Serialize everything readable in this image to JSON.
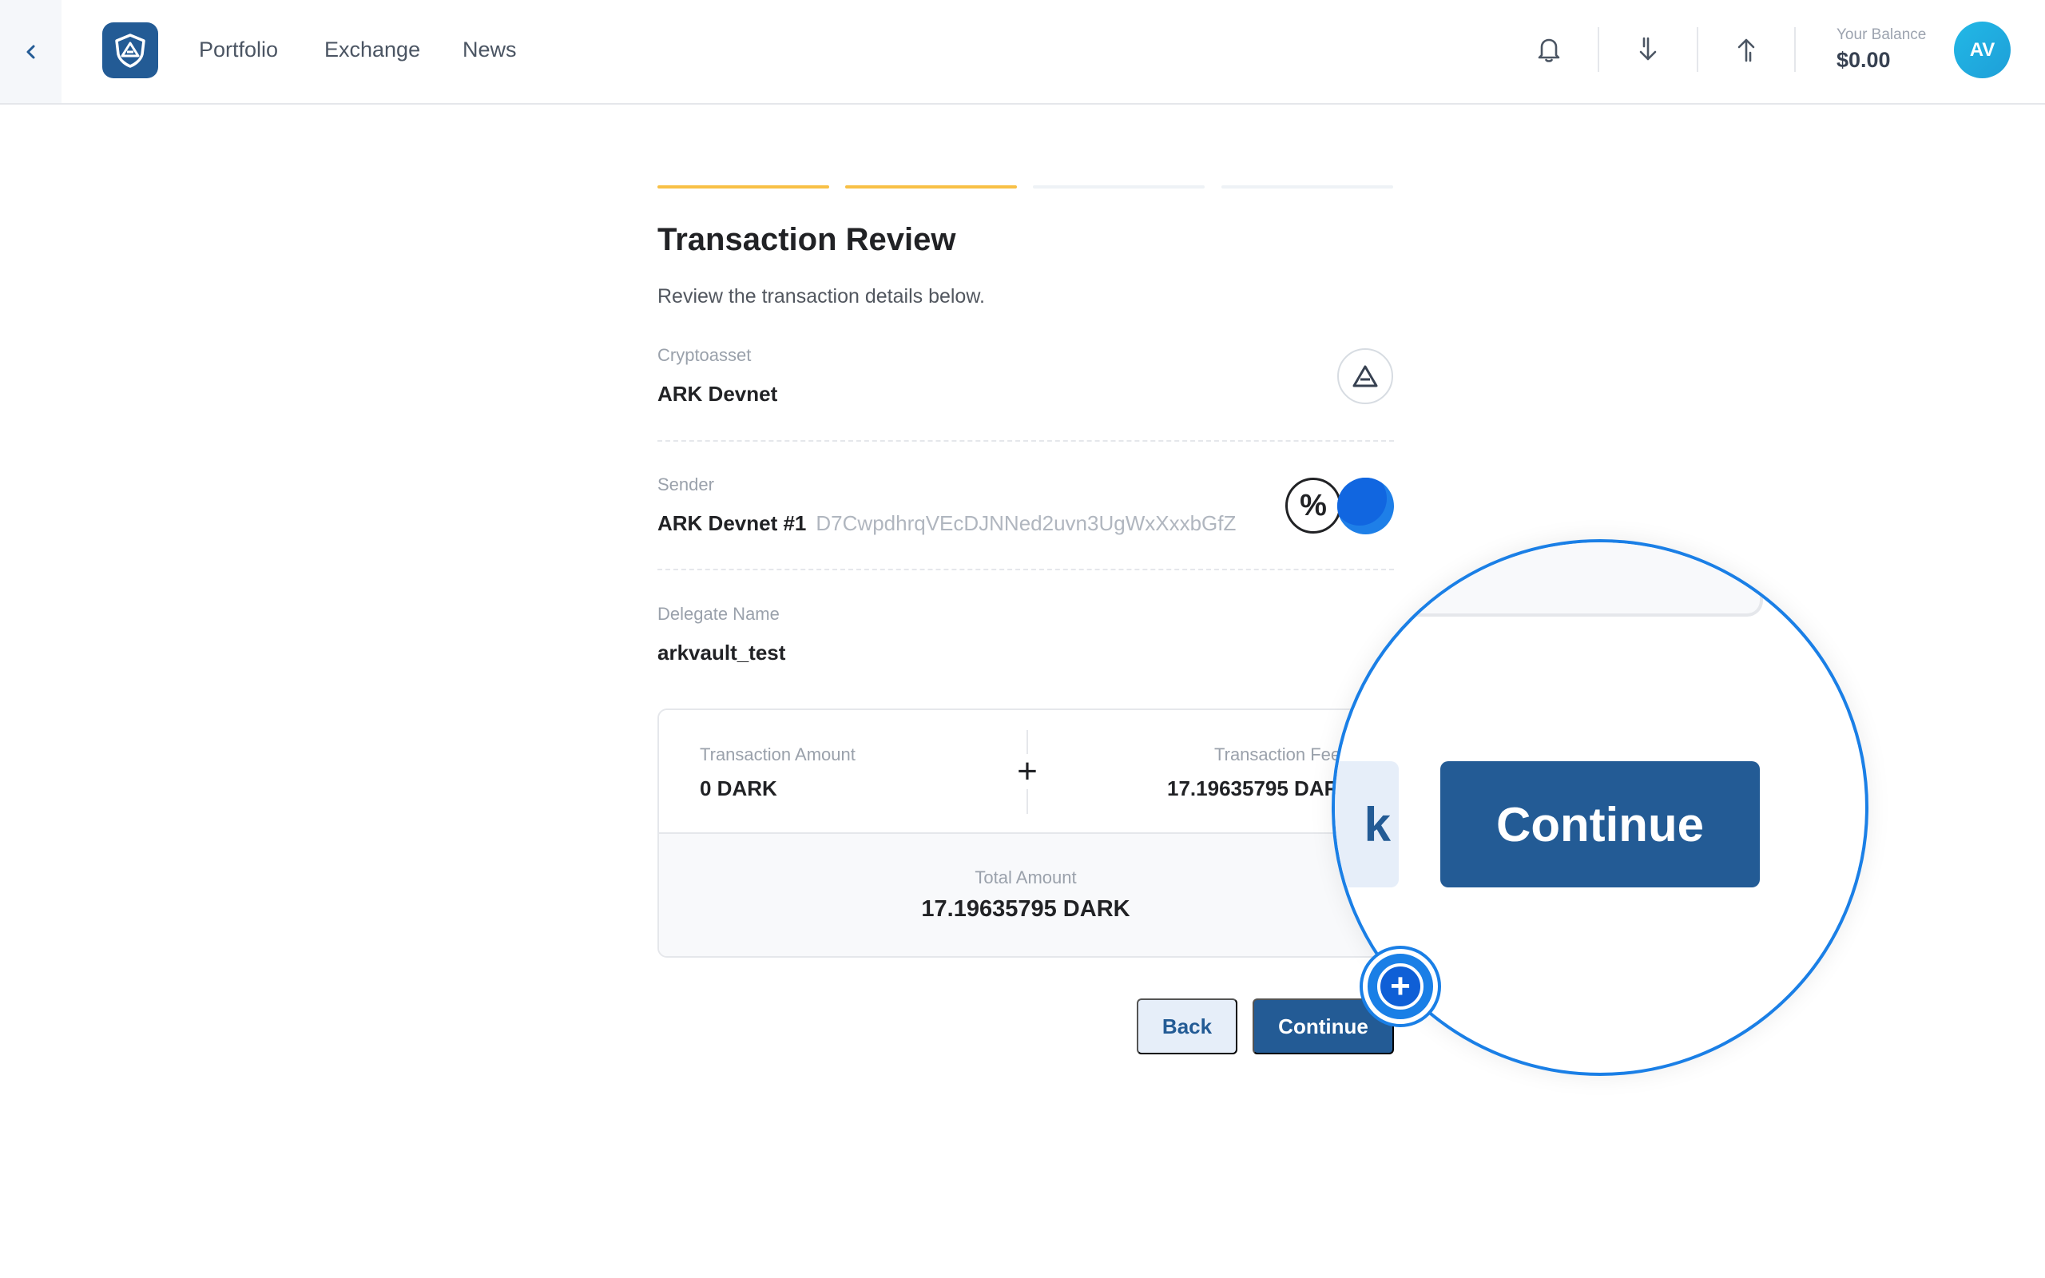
{
  "header": {
    "nav": [
      "Portfolio",
      "Exchange",
      "News"
    ],
    "balance_label": "Your Balance",
    "balance_value": "$0.00",
    "avatar_initials": "AV",
    "icons": [
      "back-chevron-icon",
      "ark-shield-logo",
      "bell-icon",
      "receive-arrow-down-icon",
      "send-arrow-up-icon"
    ]
  },
  "steps": {
    "total": 4,
    "completed": 2
  },
  "review": {
    "title": "Transaction Review",
    "subtitle": "Review the transaction details below.",
    "cryptoasset_label": "Cryptoasset",
    "cryptoasset_value": "ARK Devnet",
    "sender_label": "Sender",
    "sender_name": "ARK Devnet #1",
    "sender_address": "D7CwpdhrqVEcDJNNed2uvn3UgWxXxxbGfZ",
    "delegate_label": "Delegate Name",
    "delegate_value": "arkvault_test"
  },
  "summary": {
    "amount_label": "Transaction Amount",
    "amount_value": "0 DARK",
    "fee_label": "Transaction Fee",
    "fee_value": "17.19635795 DARK",
    "total_label": "Total Amount",
    "total_value": "17.19635795 DARK",
    "plus": "+"
  },
  "buttons": {
    "back": "Back",
    "continue": "Continue"
  },
  "magnifier": {
    "continue": "Continue",
    "back_fragment": "k",
    "plus": "+"
  },
  "colors": {
    "primary": "#235b95",
    "step_done": "#f8c046",
    "magnifier_ring": "#1a7fe6"
  }
}
